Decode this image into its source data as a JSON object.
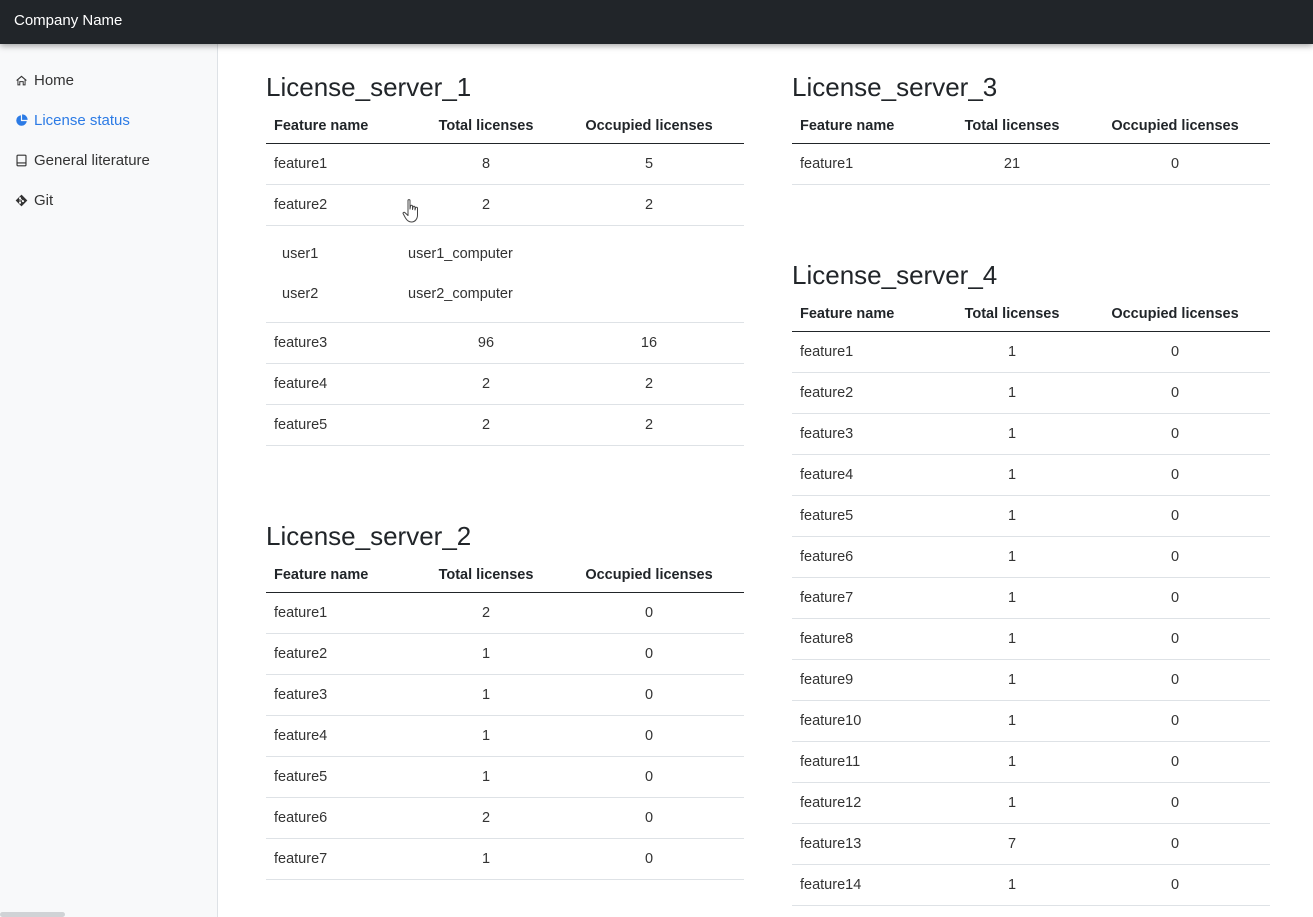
{
  "app": {
    "brand": "Company Name"
  },
  "sidebar": {
    "items": [
      {
        "label": "Home",
        "icon": "home-icon",
        "active": false
      },
      {
        "label": "License status",
        "icon": "pie-chart-icon",
        "active": true
      },
      {
        "label": "General literature",
        "icon": "book-icon",
        "active": false
      },
      {
        "label": "Git",
        "icon": "git-icon",
        "active": false
      }
    ]
  },
  "columns": {
    "feature": "Feature name",
    "total": "Total licenses",
    "occupied": "Occupied licenses"
  },
  "servers": {
    "s1": {
      "title": "License_server_1",
      "rows": [
        {
          "feature": "feature1",
          "total": "8",
          "occupied": "5"
        },
        {
          "feature": "feature2",
          "total": "2",
          "occupied": "2"
        },
        {
          "feature": "feature3",
          "total": "96",
          "occupied": "16"
        },
        {
          "feature": "feature4",
          "total": "2",
          "occupied": "2"
        },
        {
          "feature": "feature5",
          "total": "2",
          "occupied": "2"
        }
      ],
      "users": [
        {
          "user": "user1",
          "computer": "user1_computer"
        },
        {
          "user": "user2",
          "computer": "user2_computer"
        }
      ]
    },
    "s2": {
      "title": "License_server_2",
      "rows": [
        {
          "feature": "feature1",
          "total": "2",
          "occupied": "0"
        },
        {
          "feature": "feature2",
          "total": "1",
          "occupied": "0"
        },
        {
          "feature": "feature3",
          "total": "1",
          "occupied": "0"
        },
        {
          "feature": "feature4",
          "total": "1",
          "occupied": "0"
        },
        {
          "feature": "feature5",
          "total": "1",
          "occupied": "0"
        },
        {
          "feature": "feature6",
          "total": "2",
          "occupied": "0"
        },
        {
          "feature": "feature7",
          "total": "1",
          "occupied": "0"
        }
      ]
    },
    "s3": {
      "title": "License_server_3",
      "rows": [
        {
          "feature": "feature1",
          "total": "21",
          "occupied": "0"
        }
      ]
    },
    "s4": {
      "title": "License_server_4",
      "rows": [
        {
          "feature": "feature1",
          "total": "1",
          "occupied": "0"
        },
        {
          "feature": "feature2",
          "total": "1",
          "occupied": "0"
        },
        {
          "feature": "feature3",
          "total": "1",
          "occupied": "0"
        },
        {
          "feature": "feature4",
          "total": "1",
          "occupied": "0"
        },
        {
          "feature": "feature5",
          "total": "1",
          "occupied": "0"
        },
        {
          "feature": "feature6",
          "total": "1",
          "occupied": "0"
        },
        {
          "feature": "feature7",
          "total": "1",
          "occupied": "0"
        },
        {
          "feature": "feature8",
          "total": "1",
          "occupied": "0"
        },
        {
          "feature": "feature9",
          "total": "1",
          "occupied": "0"
        },
        {
          "feature": "feature10",
          "total": "1",
          "occupied": "0"
        },
        {
          "feature": "feature11",
          "total": "1",
          "occupied": "0"
        },
        {
          "feature": "feature12",
          "total": "1",
          "occupied": "0"
        },
        {
          "feature": "feature13",
          "total": "7",
          "occupied": "0"
        },
        {
          "feature": "feature14",
          "total": "1",
          "occupied": "0"
        }
      ]
    }
  },
  "colors": {
    "topbar": "#212529",
    "active_link": "#2c7be5",
    "sidebar_bg": "#f8f9fa"
  }
}
